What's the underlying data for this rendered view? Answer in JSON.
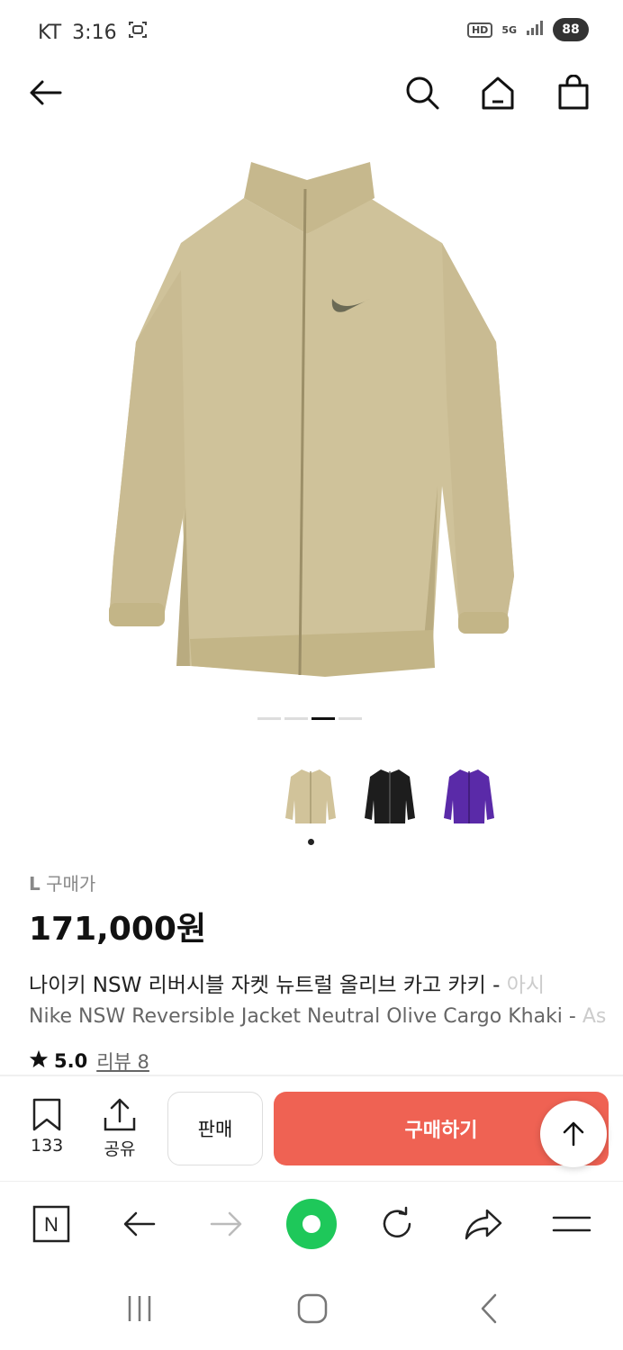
{
  "status": {
    "carrier": "KT",
    "time": "3:16",
    "hd": "HD",
    "network": "5G",
    "battery": "88"
  },
  "product": {
    "size_label": "L",
    "price_type": "구매가",
    "price": "171,000원",
    "title_ko": "나이키 NSW 리버시블 자켓 뉴트럴 올리브 카고 카키 - ",
    "title_ko_faded": "아시",
    "title_en": "Nike NSW Reversible Jacket Neutral Olive Cargo Khaki - ",
    "title_en_faded": "As",
    "rating": "5.0",
    "review_label": "리뷰 8"
  },
  "gallery": {
    "page_count": 4,
    "active_page": 3,
    "thumbnail_colors": [
      "#d1c39a",
      "#1d1d1d",
      "#5a2aa8"
    ],
    "selected_thumbnail": 1
  },
  "actions": {
    "bookmark_count": "133",
    "share_label": "공유",
    "sell_label": "판매",
    "buy_label": "구매하기"
  },
  "browser": {
    "naver_label": "N"
  },
  "colors": {
    "accent": "#ef6253",
    "green": "#1ec85a"
  }
}
